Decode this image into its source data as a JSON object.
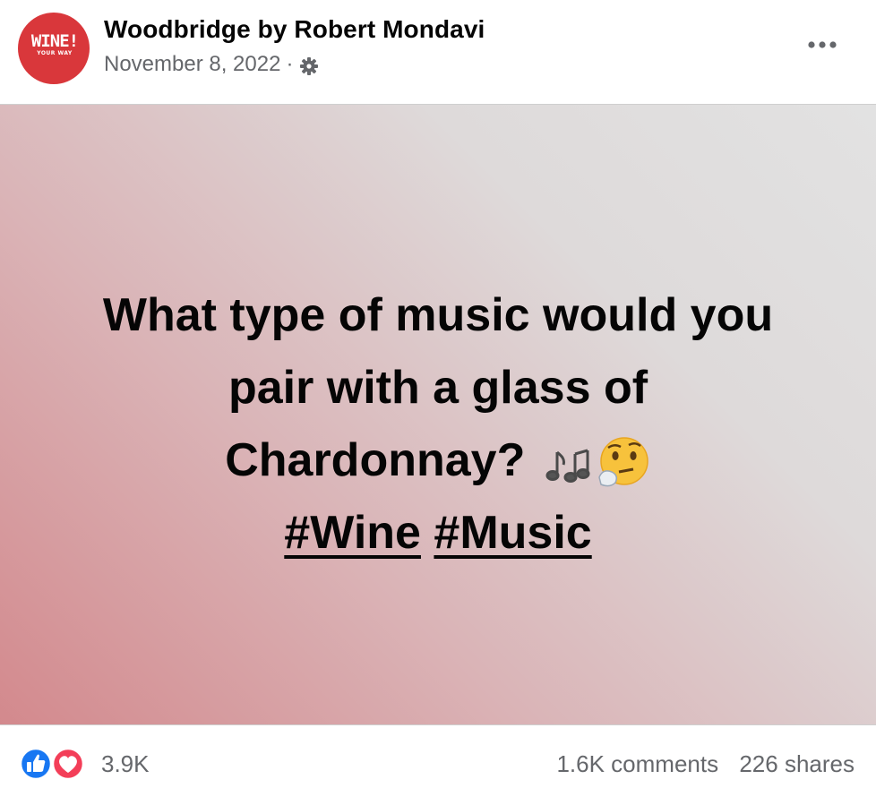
{
  "post": {
    "author": "Woodbridge by Robert Mondavi",
    "date": "November 8, 2022",
    "separator": "·",
    "avatar": {
      "logo_big": "WINE!",
      "logo_small": "YOUR WAY",
      "color": "#d9373b"
    },
    "privacy_icon": "gear-icon",
    "more_icon": "more-options-icon",
    "text_line1": "What type of music would you",
    "text_line2": "pair with a glass of",
    "text_line3": "Chardonnay?",
    "emojis": [
      "musical-notes-emoji",
      "thinking-face-emoji"
    ],
    "hashtags": [
      "#Wine",
      "#Music"
    ]
  },
  "footer": {
    "reaction_icons": [
      "like-icon",
      "love-icon"
    ],
    "reaction_count": "3.9K",
    "comments": "1.6K comments",
    "shares": "226 shares"
  },
  "colors": {
    "like": "#1877f2",
    "love": "#f33e58",
    "text_secondary": "#65676b"
  }
}
